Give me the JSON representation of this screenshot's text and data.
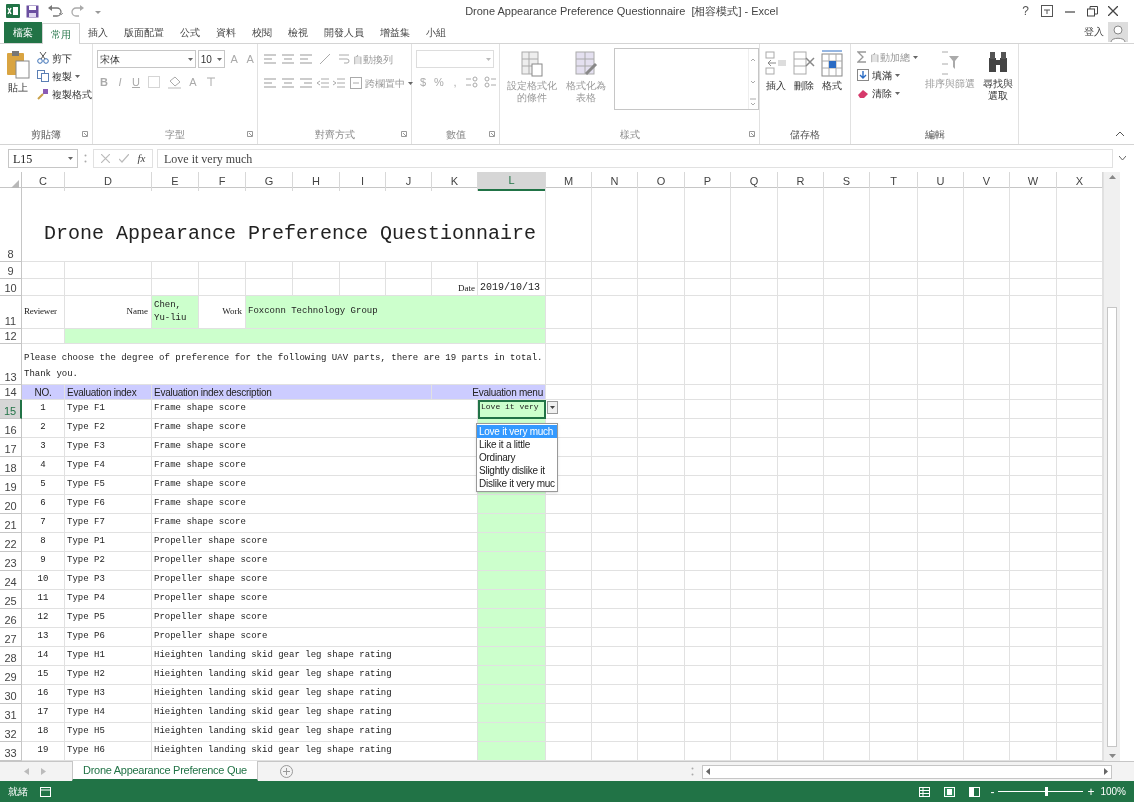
{
  "window": {
    "title": "Drone Appearance Preference Questionnaire  [相容模式] - Excel",
    "help": "?"
  },
  "ribbon_tabs": [
    {
      "label": "檔案",
      "kind": "file",
      "selected": false
    },
    {
      "label": "常用",
      "kind": "tab",
      "selected": true
    },
    {
      "label": "插入",
      "kind": "tab",
      "selected": false
    },
    {
      "label": "版面配置",
      "kind": "tab",
      "selected": false
    },
    {
      "label": "公式",
      "kind": "tab",
      "selected": false
    },
    {
      "label": "資料",
      "kind": "tab",
      "selected": false
    },
    {
      "label": "校閱",
      "kind": "tab",
      "selected": false
    },
    {
      "label": "檢視",
      "kind": "tab",
      "selected": false
    },
    {
      "label": "開發人員",
      "kind": "tab",
      "selected": false
    },
    {
      "label": "增益集",
      "kind": "tab",
      "selected": false
    },
    {
      "label": "小組",
      "kind": "tab",
      "selected": false
    }
  ],
  "sign_in": "登入",
  "ribbon_groups": [
    {
      "kind": "clipboard",
      "label": "剪貼簿",
      "disabled": false,
      "paste": "貼上",
      "cut": "剪下",
      "copy": "複製",
      "format_painter": "複製格式"
    },
    {
      "kind": "font",
      "label": "字型",
      "disabled": true,
      "font_name": "宋体",
      "font_size": "10",
      "grow": "A",
      "shrink": "A",
      "bold": "B",
      "italic": "I",
      "underline": "U",
      "font_color": "A"
    },
    {
      "kind": "alignment",
      "label": "對齊方式",
      "disabled": true,
      "wrap": "自動換列",
      "merge": "跨欄置中"
    },
    {
      "kind": "number",
      "label": "數值",
      "disabled": true,
      "currency": "$",
      "percent": "%",
      "comma": ","
    },
    {
      "kind": "styles",
      "label": "樣式",
      "disabled": true,
      "conditional": "設定格式化的條件",
      "table": "格式化為表格"
    },
    {
      "kind": "cells",
      "label": "儲存格",
      "disabled": false,
      "insert": "插入",
      "delete": "刪除",
      "format": "格式"
    },
    {
      "kind": "editing",
      "label": "編輯",
      "disabled": false,
      "autosum": "自動加總",
      "fill": "填滿",
      "clear": "清除",
      "sort": "排序與篩選",
      "find": "尋找與選取"
    }
  ],
  "formula_bar": {
    "cell_ref": "L15",
    "function_label": "fx",
    "value": "Love it very much"
  },
  "columns": [
    {
      "label": "C",
      "selected": false
    },
    {
      "label": "D",
      "selected": false
    },
    {
      "label": "E",
      "selected": false
    },
    {
      "label": "F",
      "selected": false
    },
    {
      "label": "G",
      "selected": false
    },
    {
      "label": "H",
      "selected": false
    },
    {
      "label": "I",
      "selected": false
    },
    {
      "label": "J",
      "selected": false
    },
    {
      "label": "K",
      "selected": false
    },
    {
      "label": "L",
      "selected": true
    },
    {
      "label": "M",
      "selected": false
    },
    {
      "label": "N",
      "selected": false
    },
    {
      "label": "O",
      "selected": false
    },
    {
      "label": "P",
      "selected": false
    },
    {
      "label": "Q",
      "selected": false
    },
    {
      "label": "R",
      "selected": false
    },
    {
      "label": "S",
      "selected": false
    },
    {
      "label": "T",
      "selected": false
    },
    {
      "label": "U",
      "selected": false
    },
    {
      "label": "V",
      "selected": false
    },
    {
      "label": "W",
      "selected": false
    },
    {
      "label": "X",
      "selected": false
    }
  ],
  "sheet": {
    "title": {
      "row": "8",
      "text": "Drone Appearance Preference Questionnaire"
    },
    "blank_row": {
      "row": "9"
    },
    "date_row": {
      "row": "10",
      "label": "Date",
      "value": "2019/10/13"
    },
    "reviewer_row": {
      "row": "11",
      "label": "Reviewer",
      "name_label": "Name",
      "name": "Chen, Yu-liu",
      "work_label": "Work",
      "work": "Foxconn Technology Group"
    },
    "spacer_row": {
      "row": "12"
    },
    "instruction_row": {
      "row": "13",
      "text": "Please choose the degree of preference for the following UAV parts, there are 19 parts in total. Thank you."
    },
    "header_row": {
      "row": "14",
      "no": "NO.",
      "index": "Evaluation index",
      "description": "Evaluation index description",
      "menu": "Evaluation menu"
    },
    "items": [
      {
        "row": "15",
        "no": "1",
        "index": "Type F1",
        "description": "Frame shape score",
        "selected": true
      },
      {
        "row": "16",
        "no": "2",
        "index": "Type F2",
        "description": "Frame shape score",
        "selected": false
      },
      {
        "row": "17",
        "no": "3",
        "index": "Type F3",
        "description": "Frame shape score",
        "selected": false
      },
      {
        "row": "18",
        "no": "4",
        "index": "Type F4",
        "description": "Frame shape score",
        "selected": false
      },
      {
        "row": "19",
        "no": "5",
        "index": "Type F5",
        "description": "Frame shape score",
        "selected": false
      },
      {
        "row": "20",
        "no": "6",
        "index": "Type F6",
        "description": "Frame shape score",
        "selected": false
      },
      {
        "row": "21",
        "no": "7",
        "index": "Type F7",
        "description": "Frame shape score",
        "selected": false
      },
      {
        "row": "22",
        "no": "8",
        "index": "Type P1",
        "description": "Propeller shape score",
        "selected": false
      },
      {
        "row": "23",
        "no": "9",
        "index": "Type P2",
        "description": "Propeller shape score",
        "selected": false
      },
      {
        "row": "24",
        "no": "10",
        "index": "Type P3",
        "description": "Propeller shape score",
        "selected": false
      },
      {
        "row": "25",
        "no": "11",
        "index": "Type P4",
        "description": "Propeller shape score",
        "selected": false
      },
      {
        "row": "26",
        "no": "12",
        "index": "Type P5",
        "description": "Propeller shape score",
        "selected": false
      },
      {
        "row": "27",
        "no": "13",
        "index": "Type P6",
        "description": "Propeller shape score",
        "selected": false
      },
      {
        "row": "28",
        "no": "14",
        "index": "Type H1",
        "description": "Hieighten landing skid gear leg shape rating",
        "selected": false
      },
      {
        "row": "29",
        "no": "15",
        "index": "Type H2",
        "description": "Hieighten landing skid gear leg shape rating",
        "selected": false
      },
      {
        "row": "30",
        "no": "16",
        "index": "Type H3",
        "description": "Hieighten landing skid gear leg shape rating",
        "selected": false
      },
      {
        "row": "31",
        "no": "17",
        "index": "Type H4",
        "description": "Hieighten landing skid gear leg shape rating",
        "selected": false
      },
      {
        "row": "32",
        "no": "18",
        "index": "Type H5",
        "description": "Hieighten landing skid gear leg shape rating",
        "selected": false
      },
      {
        "row": "33",
        "no": "19",
        "index": "Type H6",
        "description": "Hieighten landing skid gear leg shape rating",
        "selected": false
      }
    ]
  },
  "dropdown": {
    "cell_text": "Love it very",
    "options": [
      {
        "label": "Love it very much",
        "selected": true
      },
      {
        "label": "Like it a little",
        "selected": false
      },
      {
        "label": "Ordinary",
        "selected": false
      },
      {
        "label": "Slightly dislike it",
        "selected": false
      },
      {
        "label": "Dislike it very muc",
        "selected": false
      }
    ]
  },
  "sheet_tabs": [
    {
      "label": "Drone Appearance Preference Que",
      "selected": true
    }
  ],
  "status_bar": {
    "mode": "就緒",
    "zoom_out": "-",
    "zoom_in": "+",
    "zoom": "100%",
    "zoom_slider": {
      "level": 0.55
    }
  }
}
